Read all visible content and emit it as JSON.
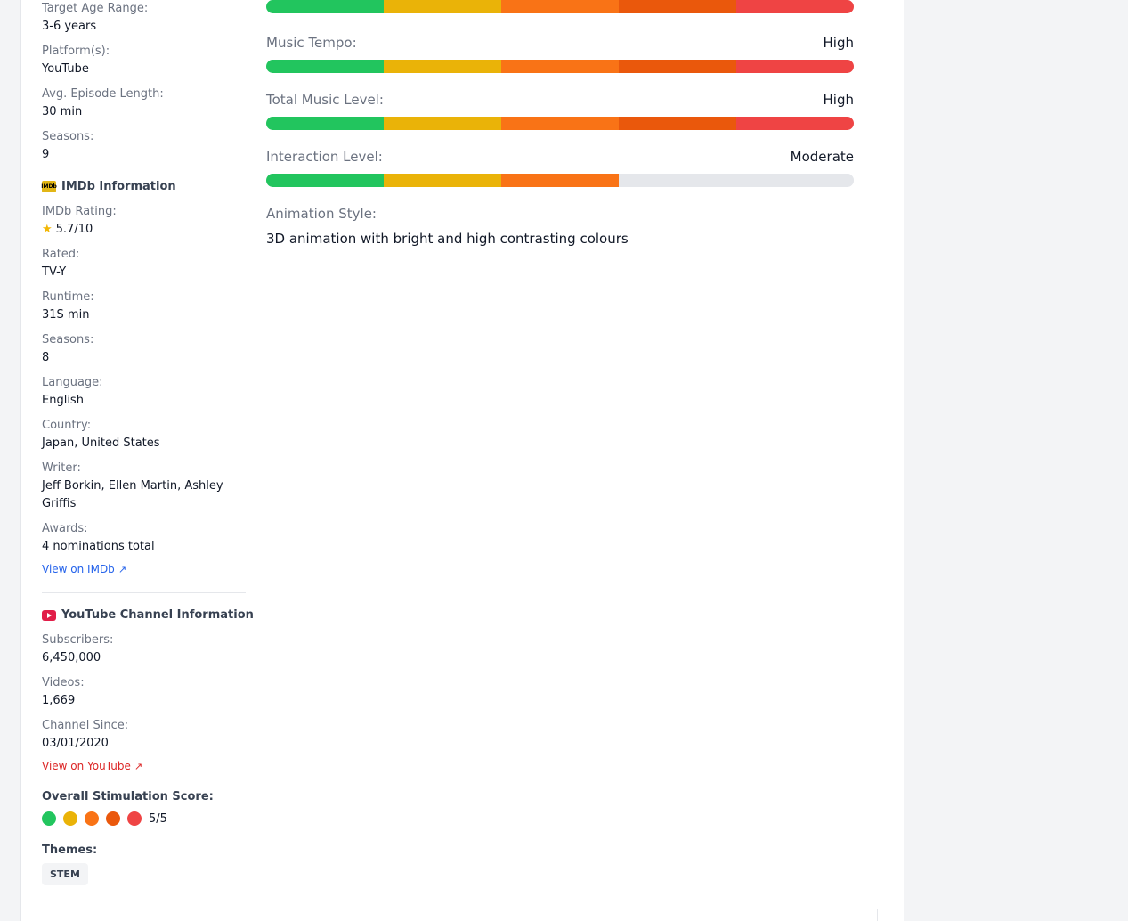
{
  "show_info": {
    "age_label": "Target Age Range:",
    "age_value": "3-6 years",
    "platform_label": "Platform(s):",
    "platform_value": "YouTube",
    "episode_label": "Avg. Episode Length:",
    "episode_value": "30 min",
    "seasons_label": "Seasons:",
    "seasons_value": "9"
  },
  "imdb": {
    "title": "IMDb Information",
    "badge": "IMDb",
    "rating_label": "IMDb Rating:",
    "rating_value": "5.7/10",
    "rated_label": "Rated:",
    "rated_value": "TV-Y",
    "runtime_label": "Runtime:",
    "runtime_value": "31S min",
    "seasons_label": "Seasons:",
    "seasons_value": "8",
    "language_label": "Language:",
    "language_value": "English",
    "country_label": "Country:",
    "country_value": "Japan, United States",
    "writer_label": "Writer:",
    "writer_value_line1": "Jeff Borkin, Ellen Martin, Ashley",
    "writer_value_line2": "Griffis",
    "awards_label": "Awards:",
    "awards_value": "4 nominations total",
    "link_label": "View on IMDb"
  },
  "youtube": {
    "title": "YouTube Channel Information",
    "subscribers_label": "Subscribers:",
    "subscribers_value": "6,450,000",
    "videos_label": "Videos:",
    "videos_value": "1,669",
    "since_label": "Channel Since:",
    "since_value": "03/01/2020",
    "link_label": "View on YouTube"
  },
  "score": {
    "label": "Overall Stimulation Score:",
    "value_text": "5/5",
    "value": 5,
    "max": 5,
    "colors": [
      "#22c55e",
      "#eab308",
      "#f97316",
      "#ea580c",
      "#ef4444"
    ]
  },
  "themes": {
    "label": "Themes:",
    "tags": [
      "STEM"
    ]
  },
  "meters": [
    {
      "name": "",
      "level": "",
      "value": 5
    },
    {
      "name": "Music Tempo:",
      "level": "High",
      "value": 5
    },
    {
      "name": "Total Music Level:",
      "level": "High",
      "value": 5
    },
    {
      "name": "Interaction Level:",
      "level": "Moderate",
      "value": 3
    }
  ],
  "animation": {
    "label": "Animation Style:",
    "value": "3D animation with bright and high contrasting colours"
  }
}
